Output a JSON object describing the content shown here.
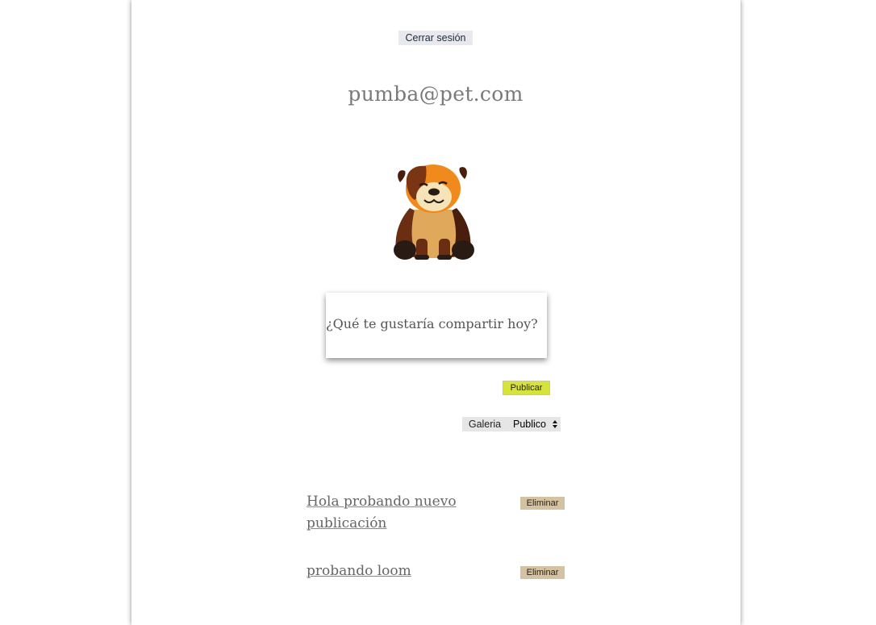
{
  "header": {
    "logout_label": "Cerrar sesión"
  },
  "profile": {
    "email": "pumba@pet.com",
    "avatar_icon": "bulldog-avatar-icon"
  },
  "composer": {
    "placeholder": "¿Qué te gustaría compartir hoy?",
    "publish_label": "Publicar",
    "gallery_label": "Galeria",
    "visibility_selected": "Publico"
  },
  "posts": [
    {
      "text": "Hola probando nuevo publicación",
      "delete_label": "Eliminar"
    },
    {
      "text": "probando loom",
      "delete_label": "Eliminar"
    }
  ],
  "colors": {
    "publish_button": "#d7e33a",
    "delete_button": "#d4c2a0",
    "secondary_button": "#e6e6e6"
  }
}
